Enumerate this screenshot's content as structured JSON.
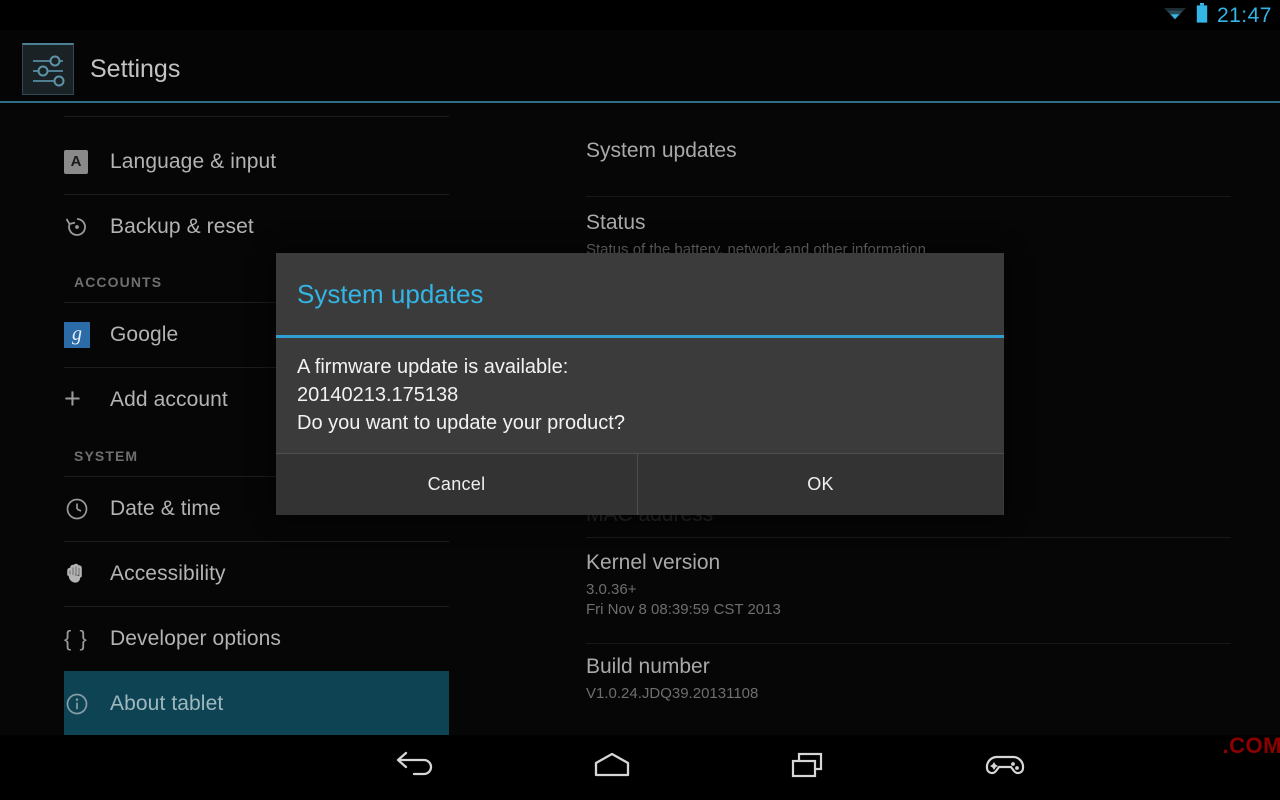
{
  "statusbar": {
    "time": "21:47",
    "icons": [
      "wifi-icon",
      "battery-icon"
    ],
    "accent_color": "#33b5e5"
  },
  "actionbar": {
    "title": "Settings",
    "icon": "settings-sliders-icon",
    "accent_color": "#2f6f86"
  },
  "sidebar": {
    "partial_top_item": "",
    "sections": [
      {
        "header": null,
        "items": [
          {
            "label": "Language & input",
            "icon": "language-input-icon",
            "selected": false
          },
          {
            "label": "Backup & reset",
            "icon": "backup-reset-icon",
            "selected": false
          }
        ]
      },
      {
        "header": "ACCOUNTS",
        "items": [
          {
            "label": "Google",
            "icon": "google-icon",
            "selected": false
          },
          {
            "label": "Add account",
            "icon": "plus-icon",
            "selected": false
          }
        ]
      },
      {
        "header": "SYSTEM",
        "items": [
          {
            "label": "Date & time",
            "icon": "clock-icon",
            "selected": false
          },
          {
            "label": "Accessibility",
            "icon": "hand-icon",
            "selected": false
          },
          {
            "label": "Developer options",
            "icon": "braces-icon",
            "selected": false
          },
          {
            "label": "About tablet",
            "icon": "info-circle-icon",
            "selected": true
          }
        ]
      }
    ],
    "selected_highlight_color": "#0d4353"
  },
  "detail": {
    "rows": [
      {
        "title": "System updates",
        "subtitle": ""
      },
      {
        "title": "Status",
        "subtitle": "Status of the battery, network and other information"
      },
      {
        "title": "Kernel version",
        "subtitle": "3.0.36+\nFri Nov 8 08:39:59 CST 2013"
      },
      {
        "title": "Build number",
        "subtitle": "V1.0.24.JDQ39.20131108"
      }
    ],
    "occluded_label": "MAC address"
  },
  "dialog": {
    "title": "System updates",
    "message_line1": "A firmware update is available:",
    "message_line2": "20140213.175138",
    "message_line3": "Do you want to update your product?",
    "cancel_label": "Cancel",
    "ok_label": "OK",
    "title_color": "#33b5e5",
    "background_color": "#3b3b3b"
  },
  "navbar": {
    "buttons": [
      {
        "name": "back-icon",
        "label": "Back"
      },
      {
        "name": "home-icon",
        "label": "Home"
      },
      {
        "name": "recents-icon",
        "label": "Recents"
      },
      {
        "name": "gamepad-icon",
        "label": "Game controller"
      }
    ]
  },
  "watermark": {
    "text": ".COM",
    "color": "#8c0000"
  }
}
